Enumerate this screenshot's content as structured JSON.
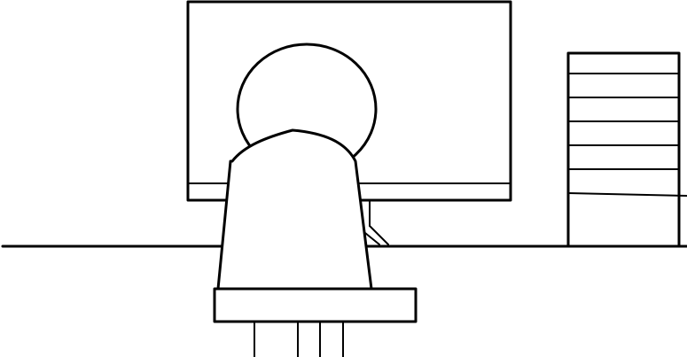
{
  "scene": {
    "elements": [
      {
        "name": "monitor-screen"
      },
      {
        "name": "monitor-stand"
      },
      {
        "name": "desk-surface"
      },
      {
        "name": "person-head"
      },
      {
        "name": "chair-back"
      },
      {
        "name": "chair-seat"
      },
      {
        "name": "chair-legs"
      },
      {
        "name": "bookshelf"
      }
    ],
    "colors": {
      "stroke": "#000000",
      "background": "#ffffff"
    }
  }
}
